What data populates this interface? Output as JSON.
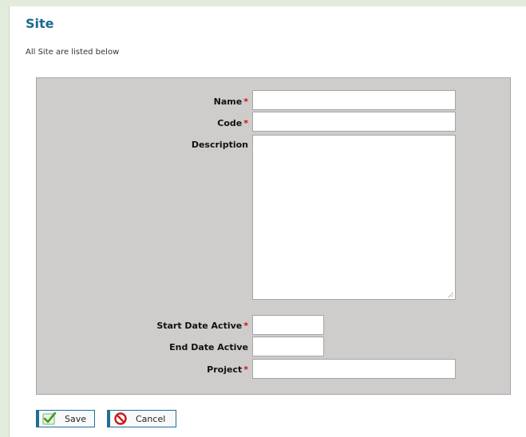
{
  "header": {
    "title": "Site",
    "subtitle": "All Site are listed below"
  },
  "form": {
    "required_marker": "*",
    "fields": [
      {
        "label": "Name",
        "required": true,
        "value": ""
      },
      {
        "label": "Code",
        "required": true,
        "value": ""
      },
      {
        "label": "Description",
        "required": false,
        "value": ""
      },
      {
        "label": "Start Date Active",
        "required": true,
        "value": ""
      },
      {
        "label": "End Date Active",
        "required": false,
        "value": ""
      },
      {
        "label": "Project",
        "required": true,
        "value": ""
      }
    ]
  },
  "actions": {
    "save_label": "Save",
    "save_icon": "check-icon",
    "cancel_label": "Cancel",
    "cancel_icon": "no-entry-icon"
  },
  "colors": {
    "title": "#1a6b8f",
    "panel": "#cfcdcb",
    "required": "#d01010",
    "button_border": "#1e6f92",
    "page_bg": "#e3ecdc"
  }
}
